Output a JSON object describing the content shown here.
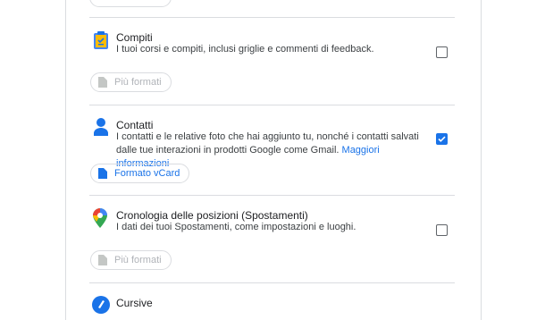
{
  "sections": [
    {
      "title": "Compiti",
      "description": "I tuoi corsi e compiti, inclusi griglie e commenti di feedback.",
      "checked": false,
      "format_label": "Più formati",
      "format_enabled": false,
      "icon": "clipboard-check-icon"
    },
    {
      "title": "Contatti",
      "description": "I contatti e le relative foto che hai aggiunto tu, nonché i contatti salvati dalle tue interazioni in prodotti Google come Gmail.",
      "link": "Maggiori informazioni",
      "checked": true,
      "format_label": "Formato vCard",
      "format_enabled": true,
      "icon": "person-icon"
    },
    {
      "title": "Cronologia delle posizioni (Spostamenti)",
      "description": "I dati dei tuoi Spostamenti, come impostazioni e luoghi.",
      "checked": false,
      "format_label": "Più formati",
      "format_enabled": false,
      "icon": "map-pin-icon"
    },
    {
      "title": "Cursive",
      "icon": "cursive-pen-icon"
    }
  ],
  "colors": {
    "accent": "#1a73e8",
    "divider": "#dadce0",
    "disabled": "#b0b3b8"
  }
}
